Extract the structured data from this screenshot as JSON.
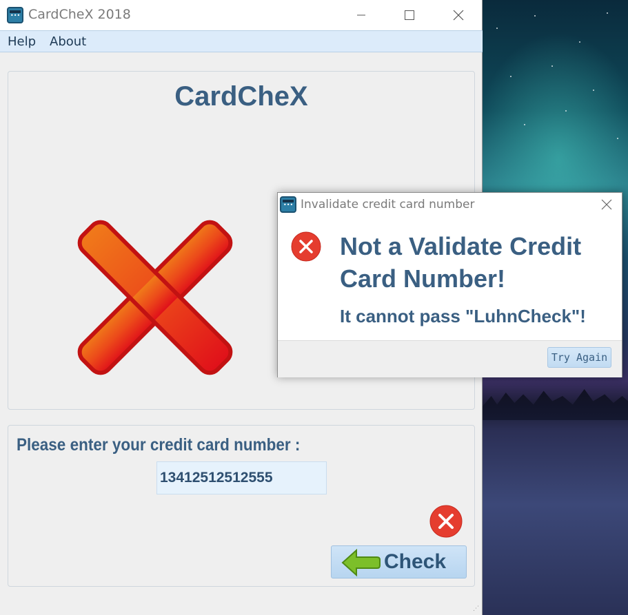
{
  "window": {
    "title": "CardCheX 2018"
  },
  "menu": {
    "items": [
      "Help",
      "About"
    ]
  },
  "main": {
    "heading": "CardCheX",
    "prompt_label": "Please enter your credit card number :",
    "card_number_value": "13412512512555",
    "check_button_label": "Check"
  },
  "dialog": {
    "title": "Invalidate credit card number",
    "message": "Not a Validate Credit Card Number!",
    "detail": "It cannot pass \"LuhnCheck\"!",
    "button_label": "Try Again"
  },
  "icons": {
    "app": "credit-card-icon",
    "status": "red-x-icon",
    "error": "error-circle-icon",
    "check": "green-arrow-icon"
  },
  "colors": {
    "accent_text": "#3a5f82",
    "menubar": "#dcebfa",
    "error_red": "#e53d2f"
  }
}
